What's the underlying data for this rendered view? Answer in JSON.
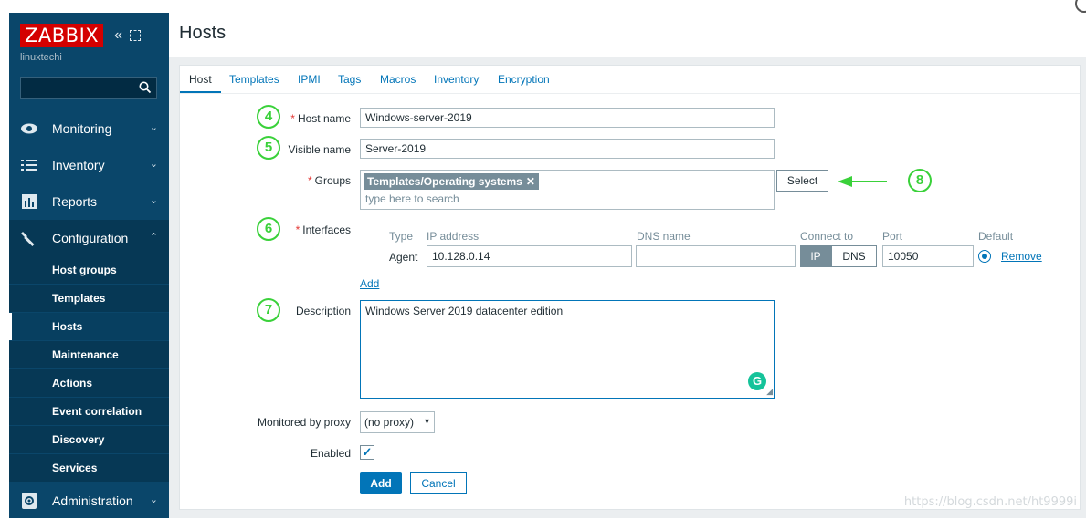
{
  "app": {
    "logo": "ZABBIX",
    "server_name": "linuxtechi",
    "collapse_icon": "«",
    "search_icon": "⚲"
  },
  "sidebar": {
    "menu": [
      {
        "label": "Monitoring",
        "icon": "eye-icon",
        "chevron": "⌄"
      },
      {
        "label": "Inventory",
        "icon": "list-icon",
        "chevron": "⌄"
      },
      {
        "label": "Reports",
        "icon": "bar-chart-icon",
        "chevron": "⌄"
      },
      {
        "label": "Configuration",
        "icon": "wrench-icon",
        "chevron": "⌃"
      }
    ],
    "submenu": [
      "Host groups",
      "Templates",
      "Hosts",
      "Maintenance",
      "Actions",
      "Event correlation",
      "Discovery",
      "Services"
    ],
    "admin": {
      "label": "Administration",
      "icon": "gear-icon",
      "chevron": "⌄"
    }
  },
  "page": {
    "title": "Hosts"
  },
  "tabs": [
    "Host",
    "Templates",
    "IPMI",
    "Tags",
    "Macros",
    "Inventory",
    "Encryption"
  ],
  "form": {
    "host_name_label": "Host name",
    "host_name_value": "Windows-server-2019",
    "visible_name_label": "Visible name",
    "visible_name_value": "Server-2019",
    "groups_label": "Groups",
    "groups_chip": "Templates/Operating systems",
    "groups_placeholder": "type here to search",
    "select_button": "Select",
    "interfaces_label": "Interfaces",
    "interfaces_columns": {
      "type": "Type",
      "ip": "IP address",
      "dns": "DNS name",
      "connect": "Connect to",
      "port": "Port",
      "default": "Default"
    },
    "interface_type": "Agent",
    "interface_ip": "10.128.0.14",
    "interface_dns": "",
    "connect_ip": "IP",
    "connect_dns": "DNS",
    "interface_port": "10050",
    "remove_link": "Remove",
    "add_link": "Add",
    "description_label": "Description",
    "description_value": "Windows Server 2019 datacenter edition",
    "proxy_label": "Monitored by proxy",
    "proxy_value": "(no proxy)",
    "enabled_label": "Enabled",
    "add_button": "Add",
    "cancel_button": "Cancel"
  },
  "annotations": [
    "4",
    "5",
    "6",
    "7",
    "8"
  ],
  "watermark": "https://blog.csdn.net/ht9999i",
  "colors": {
    "sidebar": "#0a466a",
    "accent": "#0275b8",
    "logo": "#d40000",
    "annotation": "#3ad13a"
  }
}
